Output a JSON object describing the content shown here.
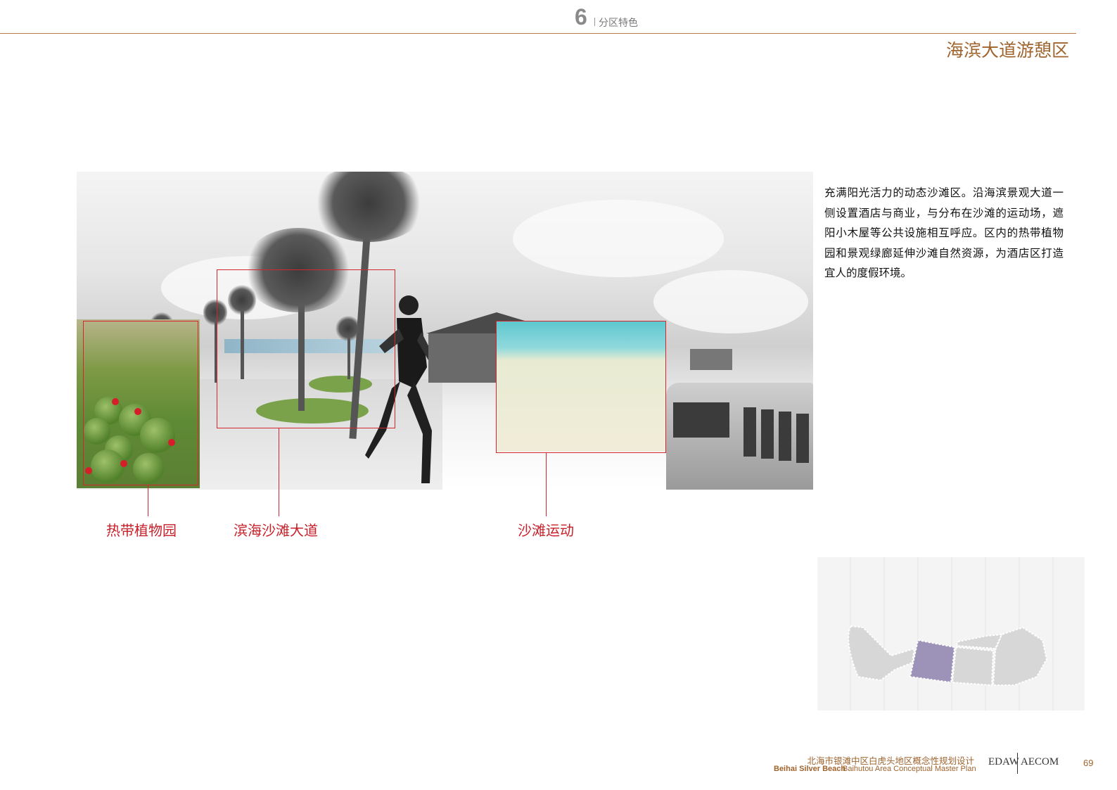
{
  "header": {
    "chapter_number": "6",
    "chapter_title": "分区特色",
    "page_title": "海滨大道游憩区"
  },
  "collage": {
    "callouts": [
      {
        "label": "热带植物园"
      },
      {
        "label": "滨海沙滩大道"
      },
      {
        "label": "沙滩运动"
      }
    ]
  },
  "description": "充满阳光活力的动态沙滩区。沿海滨景观大道一侧设置酒店与商业，与分布在沙滩的运动场，遮阳小木屋等公共设施相互呼应。区内的热带植物园和景观绿廊延伸沙滩自然资源，为酒店区打造宜人的度假环境。",
  "footer": {
    "project_cn": "北海市银滩中区白虎头地区概念性规划设计",
    "project_en_bold": "Beihai Silver Beach",
    "project_en": "Baihutou Area Conceptual Master Plan",
    "logo_left": "EDAW",
    "logo_right": "AECOM",
    "page_number": "69"
  },
  "colors": {
    "accent": "#a0642e",
    "callout_red": "#c8202a",
    "highlight_zone": "#9d92b8",
    "zone_gray": "#d7d7d7"
  }
}
